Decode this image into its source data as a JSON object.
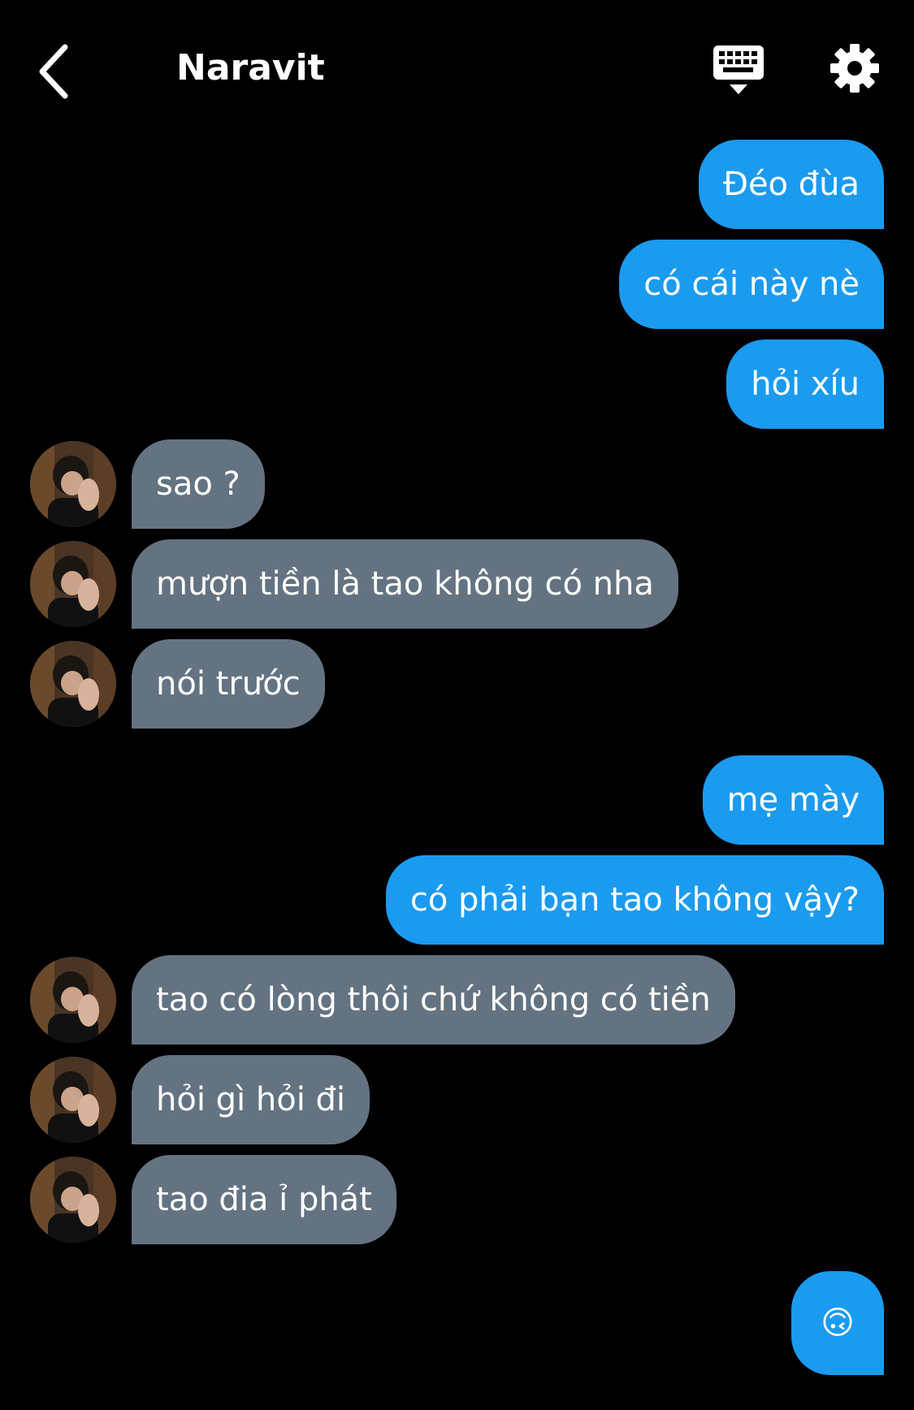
{
  "header": {
    "title": "Naravit",
    "back_icon": "chevron-left-icon",
    "keyboard_icon": "keyboard-icon",
    "settings_icon": "gear-icon"
  },
  "colors": {
    "background": "#000000",
    "outgoing_bubble": "#1a9bf0",
    "incoming_bubble": "#647381",
    "text": "#ffffff"
  },
  "messages": [
    {
      "direction": "out",
      "text": "Đéo đùa"
    },
    {
      "direction": "out",
      "text": "có cái này nè"
    },
    {
      "direction": "out",
      "text": "hỏi xíu"
    },
    {
      "direction": "in",
      "text": "sao ?"
    },
    {
      "direction": "in",
      "text": "mượn tiền là tao không có nha"
    },
    {
      "direction": "in",
      "text": "nói trước"
    },
    {
      "direction": "out",
      "text": "mẹ mày"
    },
    {
      "direction": "out",
      "text": "có phải bạn tao không vậy?"
    },
    {
      "direction": "in",
      "text": "tao có lòng thôi chứ không có tiền"
    },
    {
      "direction": "in",
      "text": "hỏi gì hỏi đi"
    },
    {
      "direction": "in",
      "text": "tao đia ỉ phát"
    },
    {
      "direction": "out",
      "text": "🙃"
    }
  ]
}
